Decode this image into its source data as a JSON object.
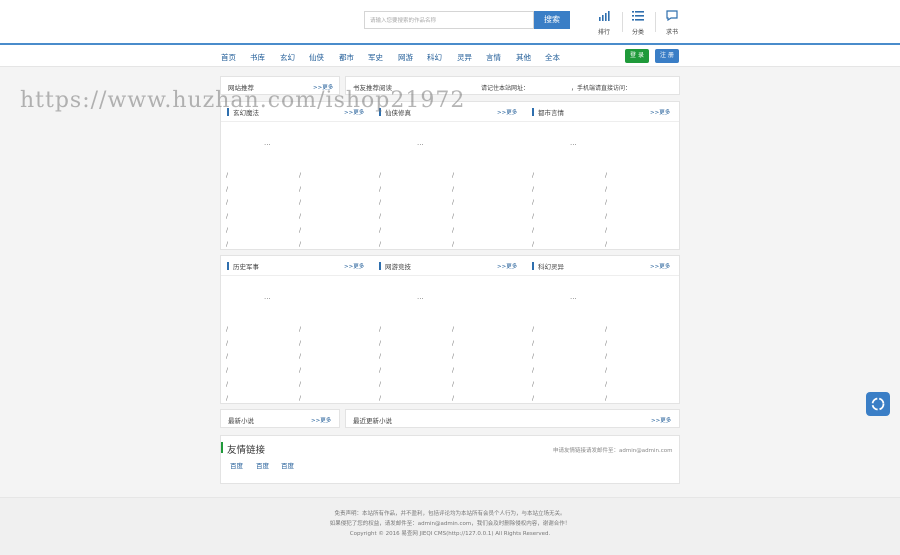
{
  "search": {
    "placeholder": "请输入您要搜索的作品名称",
    "button": "搜索"
  },
  "header_icons": [
    {
      "icon": "signal-bars-icon",
      "label": "排行"
    },
    {
      "icon": "list-icon",
      "label": "分类"
    },
    {
      "icon": "message-icon",
      "label": "求书"
    }
  ],
  "nav": {
    "items": [
      "首页",
      "书库",
      "玄幻",
      "仙侠",
      "都市",
      "军史",
      "网游",
      "科幻",
      "灵异",
      "言情",
      "其他",
      "全本"
    ],
    "login": "登 录",
    "register": "注 册"
  },
  "top_row": {
    "left_title": "网站推荐",
    "left_more": ">>更多",
    "right_title": "书友推荐阅读",
    "right_mid": "请记住本站网址：",
    "right_end": "，手机端请直接访问："
  },
  "categories": [
    {
      "title": "玄幻魔法",
      "more": ">>更多"
    },
    {
      "title": "仙侠修真",
      "more": ">>更多"
    },
    {
      "title": "都市言情",
      "more": ">>更多"
    },
    {
      "title": "历史军事",
      "more": ">>更多"
    },
    {
      "title": "网游竞技",
      "more": ">>更多"
    },
    {
      "title": "科幻灵异",
      "more": ">>更多"
    }
  ],
  "placeholder_text": "...",
  "slash": "/",
  "bottom_row": {
    "left_title": "最新小说",
    "left_more": ">>更多",
    "right_title": "最近更新小说",
    "right_more": ">>更多"
  },
  "links": {
    "title": "友情链接",
    "note": "申请友情链接请发邮件至：admin@admin.com",
    "items": [
      "百度",
      "百度",
      "百度"
    ]
  },
  "footer": {
    "line1": "免责声明：本站所有作品，并不盈利，包括评论均为本站所有会员个人行为，与本站立场无关。",
    "line2": "如果侵犯了您的权益，请发邮件至：admin@admin.com，我们会及时删除侵权内容，谢谢合作！",
    "line3": "Copyright © 2016 易查网 JIEQI CMS(http://127.0.0.1) All Rights Reserved."
  },
  "watermark": "https://www.huzhan.com/ishop21972",
  "colors": {
    "accent": "#3a7ec6",
    "login": "#1f9a3a",
    "register": "#3a7ec6"
  }
}
